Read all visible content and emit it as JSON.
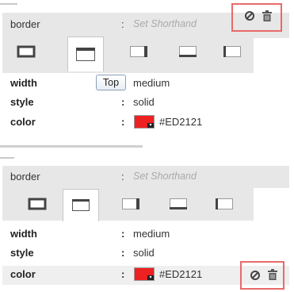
{
  "colors": {
    "accent_red": "#ED2121",
    "highlight_border": "#E86A6A",
    "panel_bg": "#E7E7E7"
  },
  "panels": [
    {
      "property": "border",
      "shorthand_placeholder": "Set Shorthand",
      "colon": ":",
      "tabs": [
        "all-borders",
        "top",
        "right",
        "bottom",
        "left"
      ],
      "active_tab": "top",
      "tooltip": "Top",
      "rows": [
        {
          "label": "width",
          "value": "medium"
        },
        {
          "label": "style",
          "value": "solid"
        },
        {
          "label": "color",
          "value": "#ED2121"
        }
      ],
      "actions": [
        "disable-icon",
        "trash-icon"
      ]
    },
    {
      "property": "border",
      "shorthand_placeholder": "Set Shorthand",
      "colon": ":",
      "tabs": [
        "all-borders",
        "top",
        "right",
        "bottom",
        "left"
      ],
      "active_tab": "top",
      "rows": [
        {
          "label": "width",
          "value": "medium"
        },
        {
          "label": "style",
          "value": "solid"
        },
        {
          "label": "color",
          "value": "#ED2121"
        }
      ],
      "actions": [
        "disable-icon",
        "trash-icon"
      ]
    }
  ]
}
